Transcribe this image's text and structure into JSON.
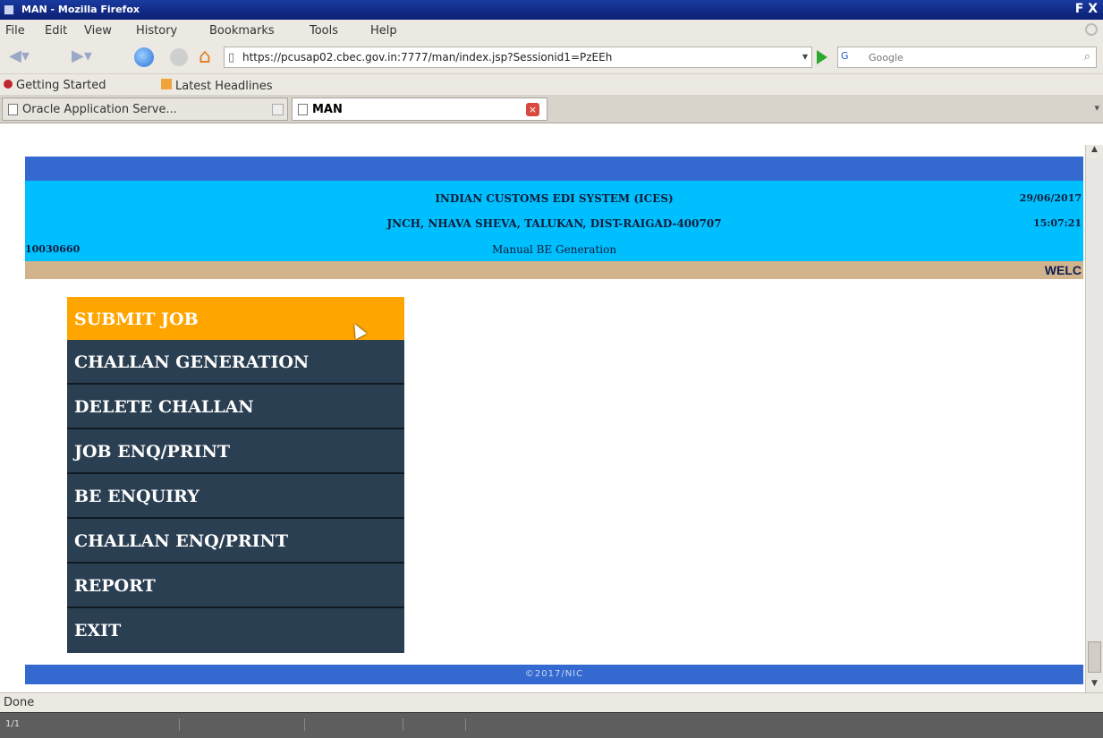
{
  "window": {
    "title": "MAN - Mozilla Firefox",
    "buttons": "F X"
  },
  "menubar": [
    "File",
    "Edit",
    "View",
    "History",
    "Bookmarks",
    "Tools",
    "Help"
  ],
  "toolbar": {
    "url": "https://pcusap02.cbec.gov.in:7777/man/index.jsp?Sessionid1=PzEEh",
    "search_placeholder": "Google",
    "search_engine": "G"
  },
  "bookmarks": [
    "Getting Started",
    "Latest Headlines"
  ],
  "tabs": [
    {
      "label": "Oracle Application Serve...",
      "active": false
    },
    {
      "label": "MAN",
      "active": true
    }
  ],
  "header": {
    "line1": "INDIAN CUSTOMS EDI SYSTEM (ICES)",
    "line2": "JNCH, NHAVA SHEVA, TALUKAN, DIST-RAIGAD-400707",
    "line3": "Manual BE Generation",
    "date": "29/06/2017",
    "time": "15:07:21",
    "user_id": "10030660",
    "welcome": "WELC"
  },
  "menu": [
    "SUBMIT JOB",
    "CHALLAN GENERATION",
    "DELETE CHALLAN",
    "JOB ENQ/PRINT",
    "BE ENQUIRY",
    "CHALLAN ENQ/PRINT",
    "REPORT",
    "EXIT"
  ],
  "footer": "©2017/NIC",
  "status": "Done",
  "taskbar": {
    "workspace": "1/1"
  },
  "colors": {
    "top_band": "#3469d0",
    "header_bg": "#00bfff",
    "tan_band": "#d2b48c",
    "menu_bg": "#2b3f52",
    "menu_active": "#ffa500"
  }
}
